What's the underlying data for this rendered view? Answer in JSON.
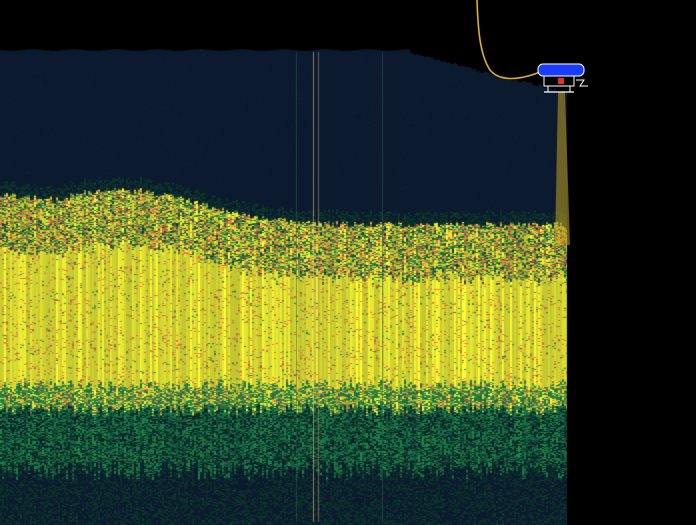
{
  "scene": {
    "kind": "sonar-echogram",
    "colors": {
      "background": "#000000",
      "water_column": "#0b1a2e",
      "weak_return": "#0f3d2a",
      "medium_return": "#1f8a4a",
      "strong_return": "#ffff33",
      "peak_return": "#ff7a4d",
      "tether": "#e0b020",
      "vehicle_body": "#1a3cff",
      "beam": "#c0a020"
    }
  }
}
